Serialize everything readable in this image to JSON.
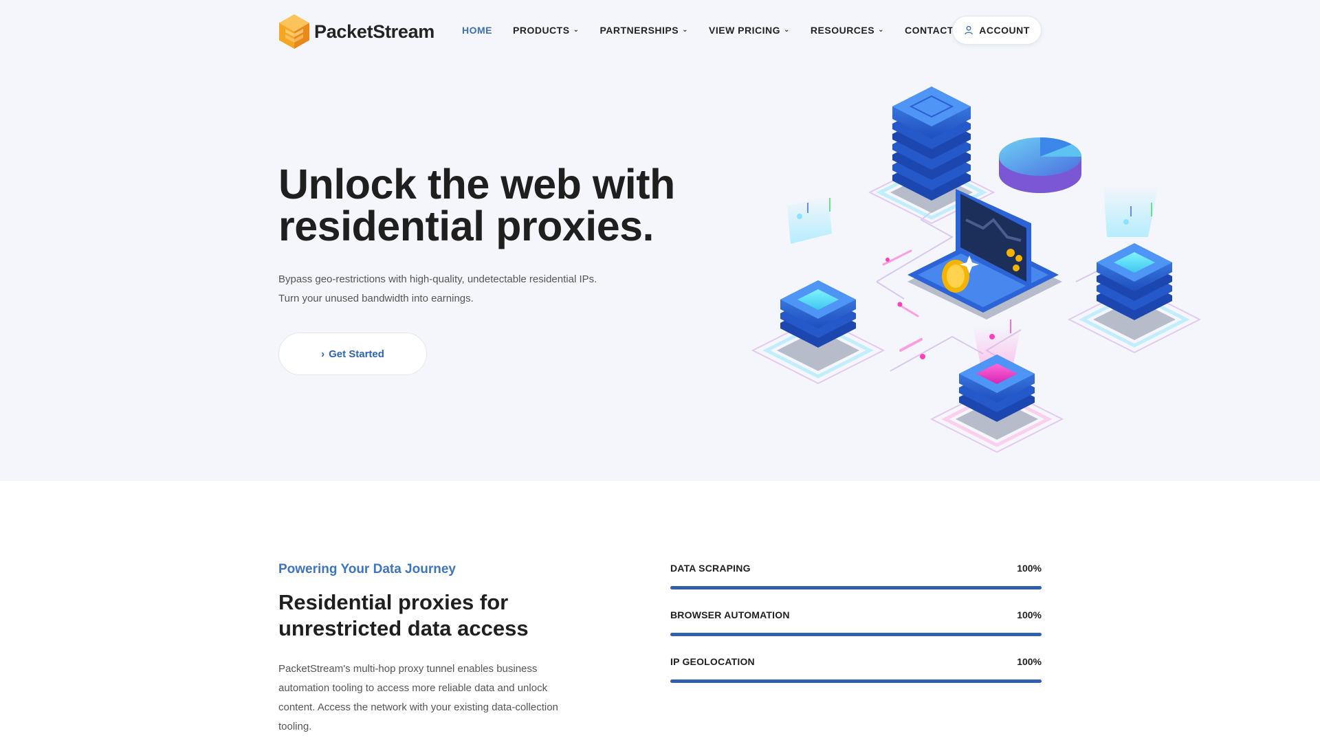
{
  "brand": {
    "name": "PacketStream",
    "accent": "#3d6fb8",
    "logo_color": "#f5a623"
  },
  "nav": {
    "items": [
      {
        "label": "HOME",
        "active": true,
        "has_caret": false
      },
      {
        "label": "PRODUCTS",
        "active": false,
        "has_caret": true
      },
      {
        "label": "PARTNERSHIPS",
        "active": false,
        "has_caret": true
      },
      {
        "label": "VIEW PRICING",
        "active": false,
        "has_caret": true
      },
      {
        "label": "RESOURCES",
        "active": false,
        "has_caret": true
      },
      {
        "label": "CONTACT",
        "active": false,
        "has_caret": false
      }
    ],
    "account_label": "ACCOUNT",
    "account_icon": "user-icon",
    "caret_icon": "chevron-down-icon"
  },
  "hero": {
    "title": "Unlock the web with residential proxies.",
    "subtitle_line1": "Bypass geo-restrictions with high-quality, undetectable residential IPs.",
    "subtitle_line2": "Turn your unused bandwidth into earnings.",
    "cta_label": "Get Started",
    "cta_icon": "chevron-right-icon"
  },
  "section": {
    "eyebrow": "Powering Your Data Journey",
    "title": "Residential proxies for unrestricted data access",
    "body": "PacketStream's multi-hop proxy tunnel enables business automation tooling to access more reliable data and unlock content. Access the network with your existing data-collection tooling."
  },
  "skills": [
    {
      "label": "DATA SCRAPING",
      "value_text": "100%",
      "value": 100
    },
    {
      "label": "BROWSER AUTOMATION",
      "value_text": "100%",
      "value": 100
    },
    {
      "label": "IP GEOLOCATION",
      "value_text": "100%",
      "value": 100
    }
  ]
}
